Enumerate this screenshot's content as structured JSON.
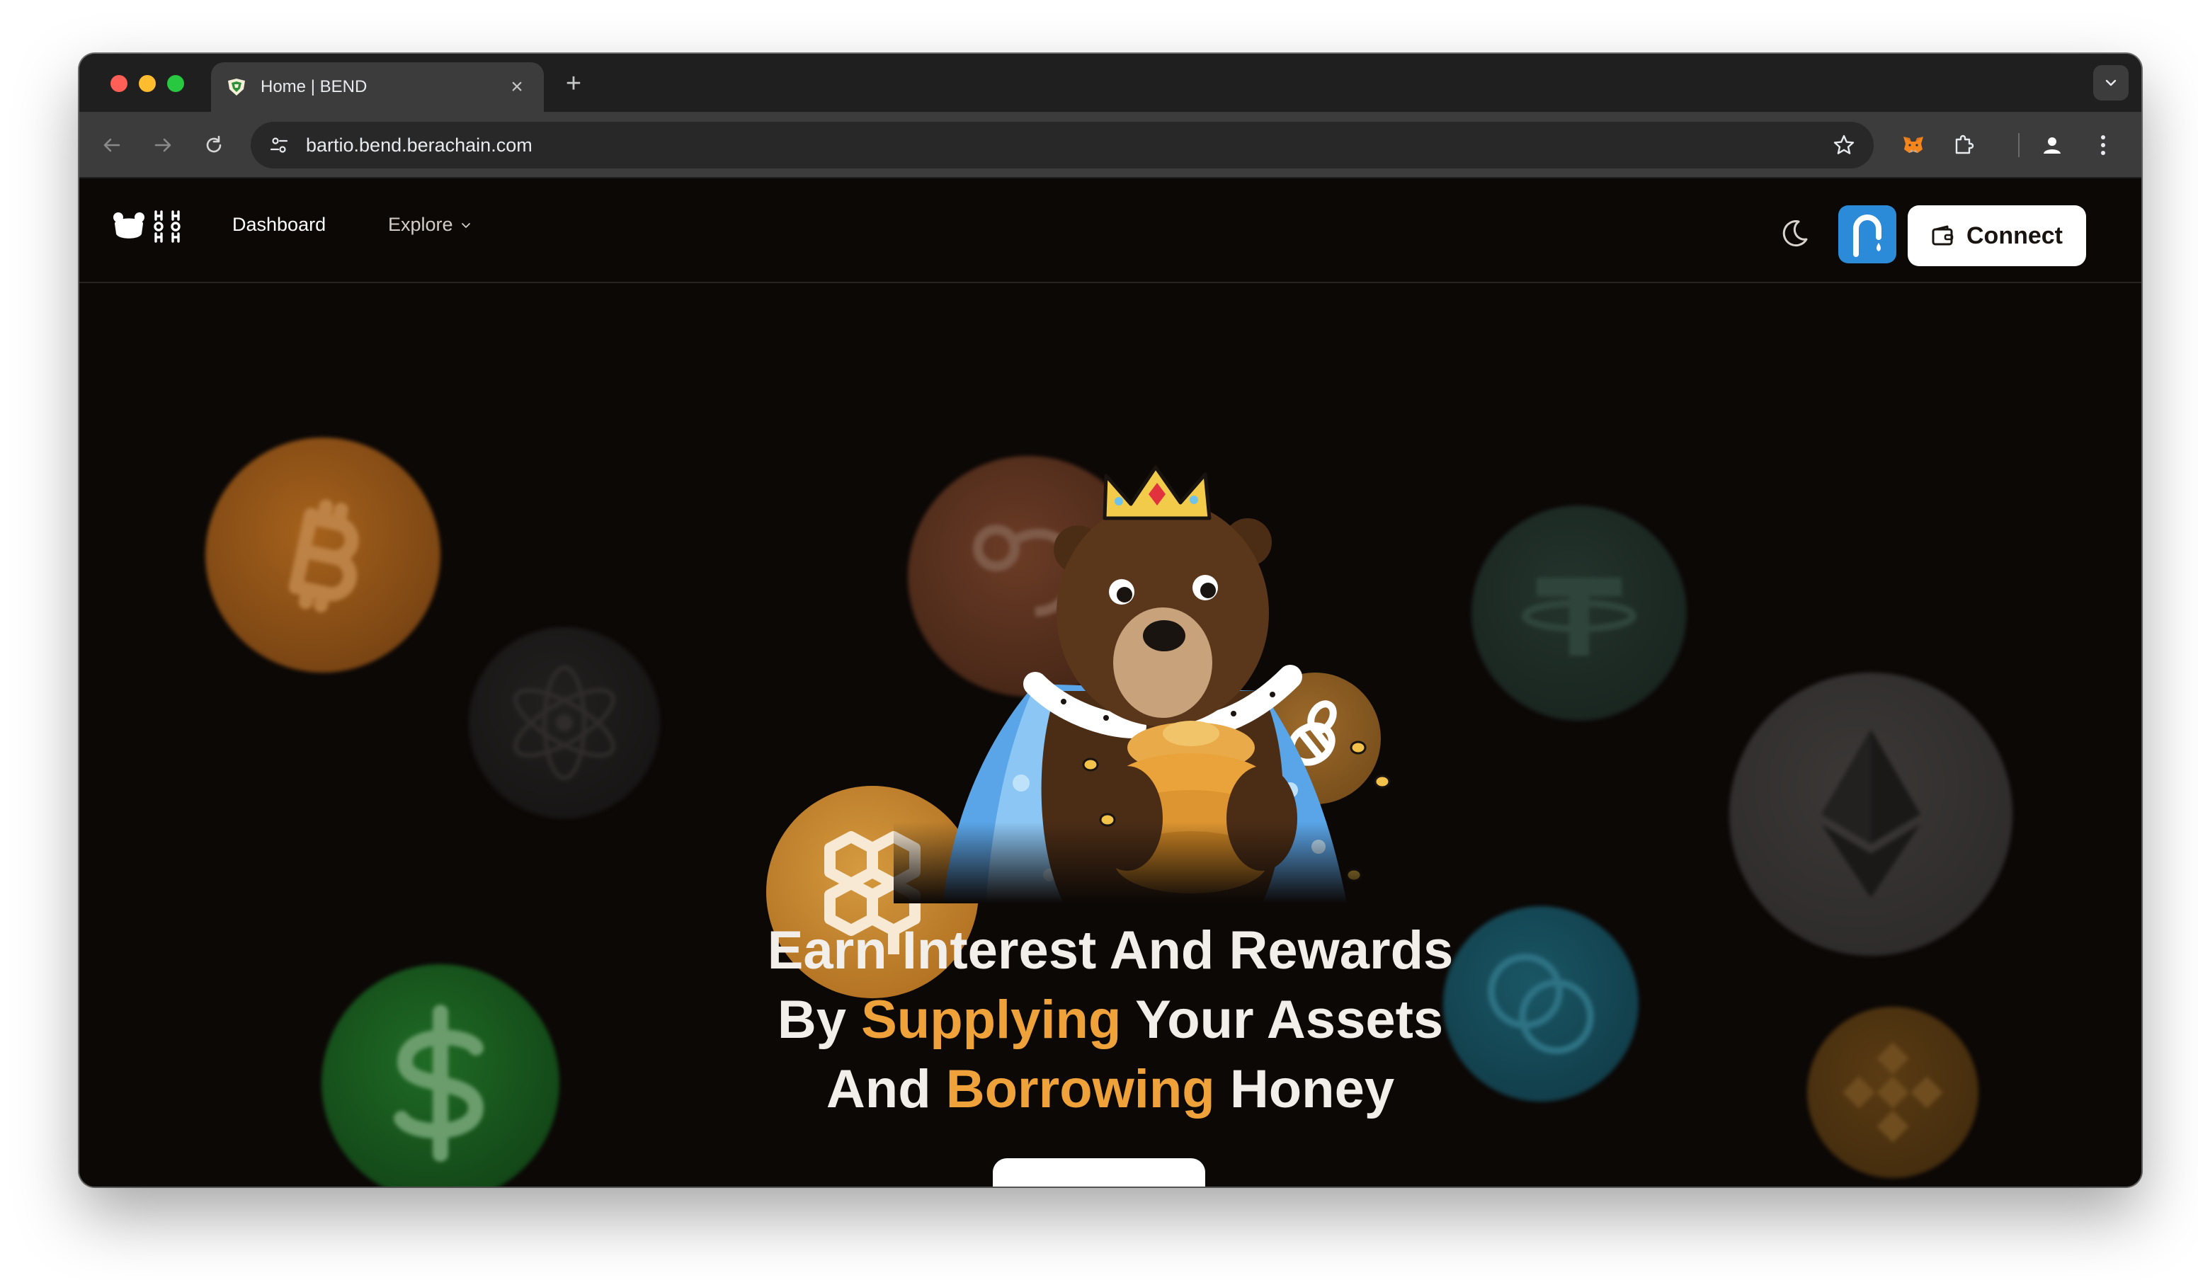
{
  "browser": {
    "tab_title": "Home | BEND",
    "tab_close": "×",
    "new_tab": "+",
    "url": "bartio.bend.berachain.com"
  },
  "nav": {
    "dashboard": "Dashboard",
    "explore": "Explore",
    "connect": "Connect"
  },
  "hero": {
    "line1": "Earn Interest And Rewards",
    "line2_pre": "By ",
    "line2_accent": "Supplying",
    "line2_post": " Your Assets",
    "line3_pre": "And ",
    "line3_accent": "Borrowing",
    "line3_post": " Honey"
  },
  "colors": {
    "accent": "#f0a23a",
    "background": "#0c0806",
    "faucet": "#2b8bd8"
  },
  "icons": [
    "back-icon",
    "forward-icon",
    "reload-icon",
    "site-settings-icon",
    "bookmark-star-icon",
    "metamask-extension-icon",
    "extensions-puzzle-icon",
    "profile-icon",
    "browser-menu-icon",
    "moon-icon",
    "faucet-icon",
    "wallet-icon"
  ]
}
